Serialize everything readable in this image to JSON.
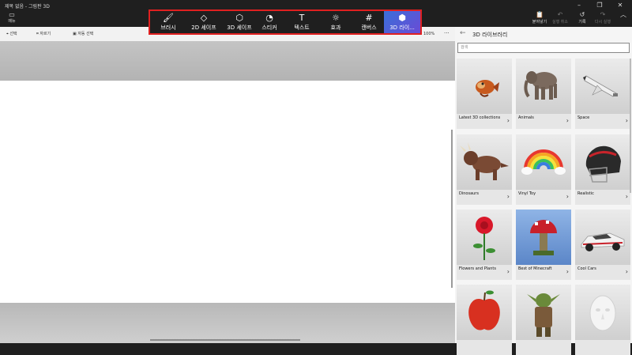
{
  "window": {
    "title": "제목 없음 - 그림판 3D",
    "minimize": "–",
    "maximize": "❐",
    "close": "✕"
  },
  "menu": {
    "label": "메뉴",
    "icon": "folder-icon"
  },
  "tools": [
    {
      "label": "브러시",
      "icon": "brush-icon",
      "active": false
    },
    {
      "label": "2D 셰이프",
      "icon": "shapes-2d-icon",
      "active": false
    },
    {
      "label": "3D 셰이프",
      "icon": "cube-icon",
      "active": false
    },
    {
      "label": "스티커",
      "icon": "sticker-icon",
      "active": false
    },
    {
      "label": "텍스트",
      "icon": "text-icon",
      "active": false
    },
    {
      "label": "효과",
      "icon": "effects-icon",
      "active": false
    },
    {
      "label": "캔버스",
      "icon": "canvas-icon",
      "active": false
    },
    {
      "label": "3D 라이...",
      "icon": "library-3d-icon",
      "active": true
    }
  ],
  "right_tools": [
    {
      "label": "붙여넣기",
      "icon": "paste-icon",
      "disabled": false
    },
    {
      "label": "실행 취소",
      "icon": "undo-icon",
      "disabled": true
    },
    {
      "label": "기록",
      "icon": "history-icon",
      "disabled": false
    },
    {
      "label": "다시 실행",
      "icon": "redo-icon",
      "disabled": true
    },
    {
      "label": "",
      "icon": "collapse-chevron-icon",
      "disabled": false
    }
  ],
  "subbar": {
    "select": "선택",
    "crop": "자르기",
    "magic_select": "자동 선택",
    "zoom": "100%",
    "more": "···"
  },
  "panel": {
    "title": "3D 라이브러리",
    "search_placeholder": "검색",
    "categories": [
      {
        "label": "Latest 3D collections"
      },
      {
        "label": "Animals"
      },
      {
        "label": "Space"
      },
      {
        "label": "Dinosaurs"
      },
      {
        "label": "Vinyl Toy"
      },
      {
        "label": "Realistic"
      },
      {
        "label": "Flowers and Plants"
      },
      {
        "label": "Best of Minecraft"
      },
      {
        "label": "Cool Cars"
      },
      {
        "label": ""
      },
      {
        "label": ""
      },
      {
        "label": ""
      }
    ]
  },
  "colors": {
    "accent_start": "#3a6fd8",
    "accent_end": "#6a4bd6",
    "highlight_border": "#e02020"
  }
}
